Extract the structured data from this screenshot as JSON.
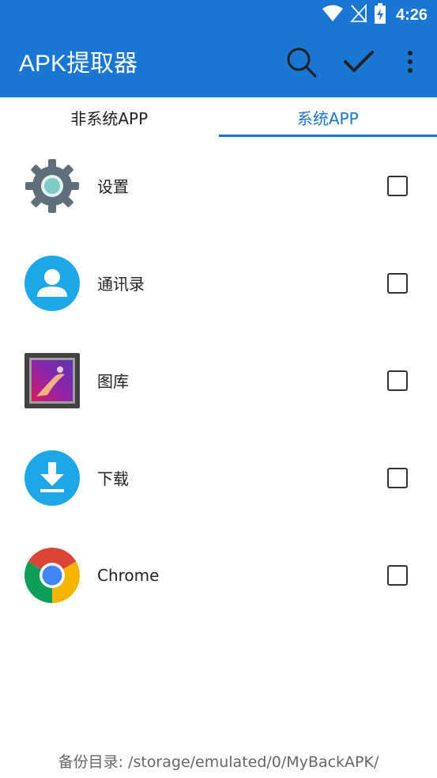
{
  "status_bar": {
    "time": "4:26",
    "icons": [
      "wifi-icon",
      "no-signal-icon",
      "battery-charging-icon"
    ]
  },
  "app_bar": {
    "title": "APK提取器",
    "actions": [
      "search-icon",
      "check-icon",
      "more-vert-icon"
    ]
  },
  "tabs": [
    {
      "label": "非系统APP",
      "active": false
    },
    {
      "label": "系统APP",
      "active": true
    }
  ],
  "apps": [
    {
      "name": "设置",
      "icon": "settings-gear-icon",
      "checked": false
    },
    {
      "name": "通讯录",
      "icon": "contacts-icon",
      "checked": false
    },
    {
      "name": "图库",
      "icon": "gallery-icon",
      "checked": false
    },
    {
      "name": "下载",
      "icon": "download-icon",
      "checked": false
    },
    {
      "name": "Chrome",
      "icon": "chrome-icon",
      "checked": false
    }
  ],
  "footer": {
    "backup_path": "备份目录: /storage/emulated/0/MyBackAPK/"
  },
  "colors": {
    "primary": "#1976d2",
    "text": "#222222",
    "footer_text": "#666666"
  }
}
